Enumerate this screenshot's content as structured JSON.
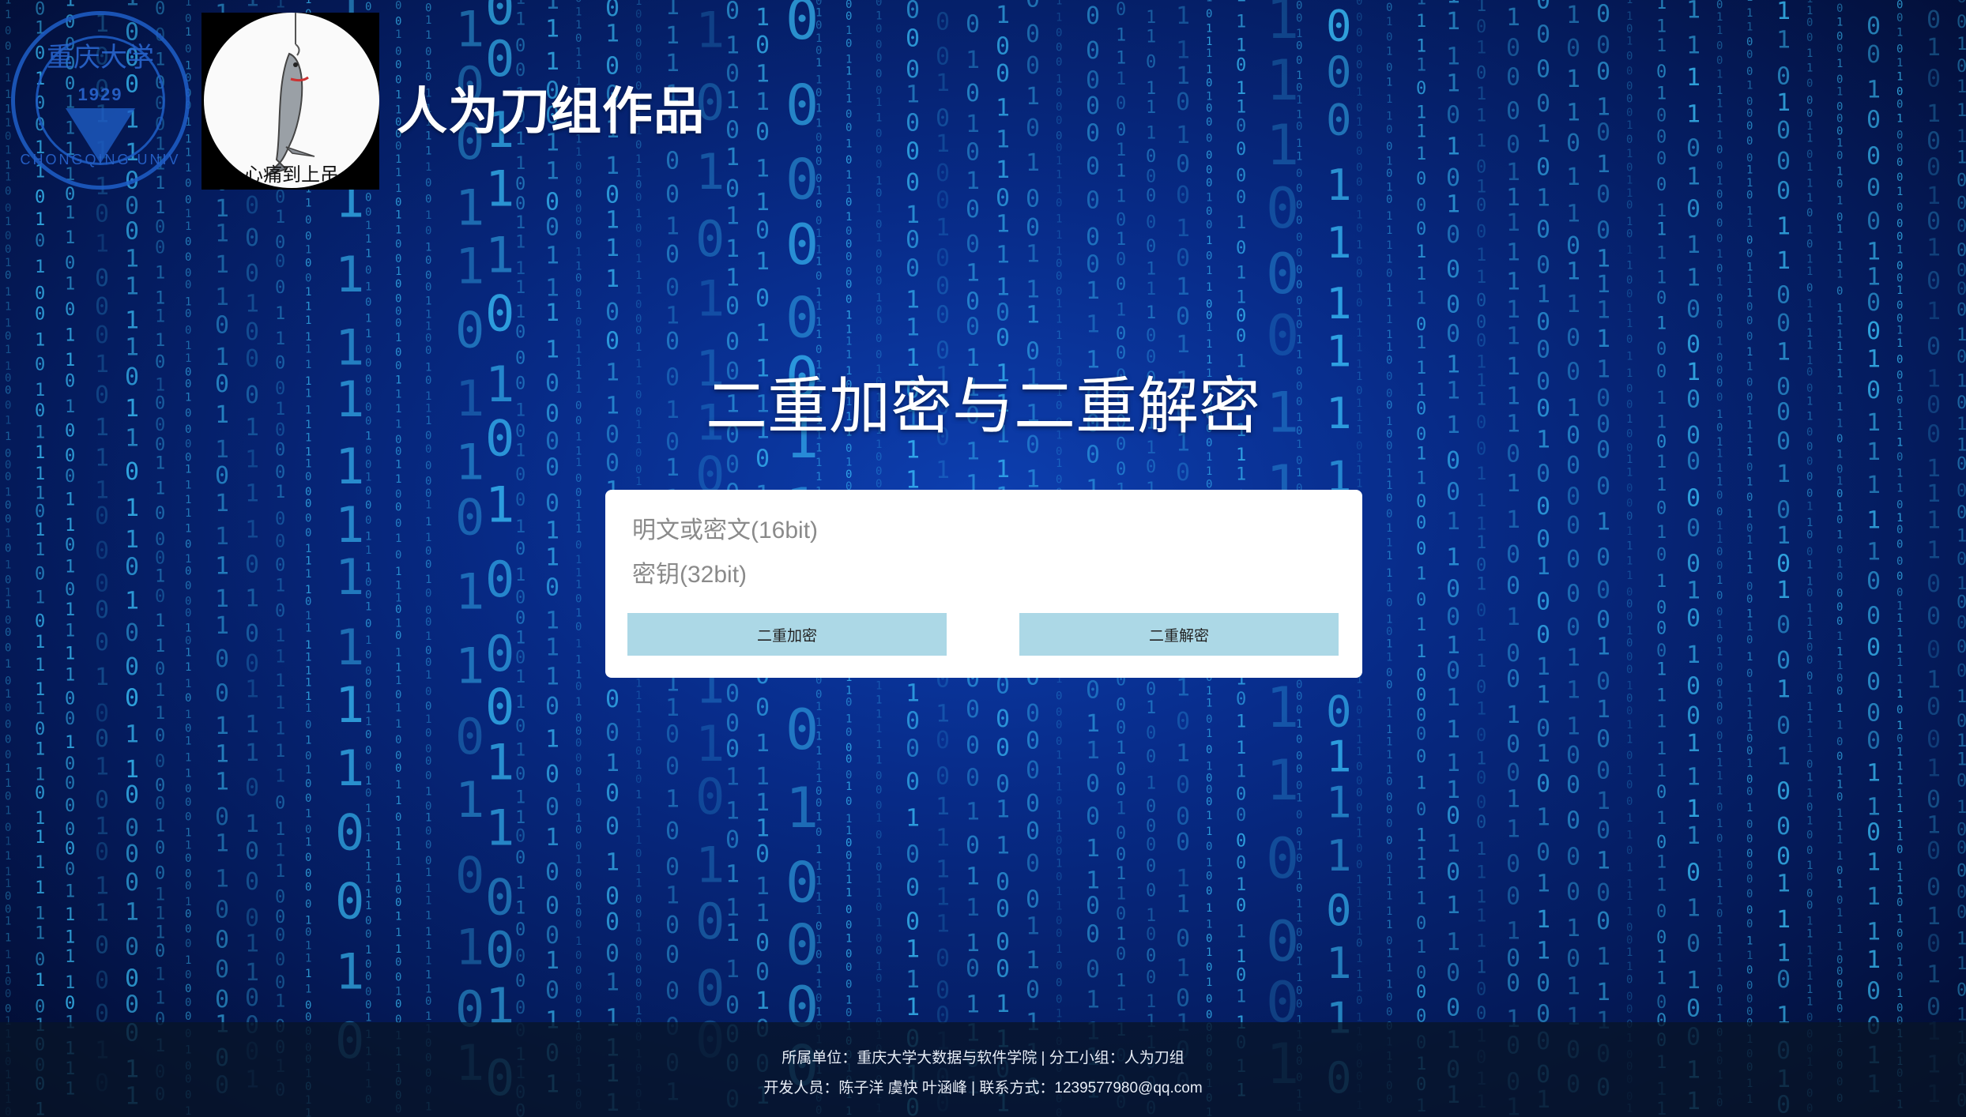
{
  "header": {
    "seal_top_text": "重庆大学",
    "seal_year": "1929",
    "seal_bottom_text": "CHONGQING UNIV",
    "avatar_caption": "心痛到上吊",
    "brand_title": "人为刀组作品"
  },
  "main": {
    "title": "二重加密与二重解密",
    "inputs": [
      {
        "placeholder": "明文或密文(16bit)",
        "value": ""
      },
      {
        "placeholder": "密钥(32bit)",
        "value": ""
      }
    ],
    "buttons": {
      "encrypt": "二重加密",
      "decrypt": "二重解密"
    }
  },
  "footer": {
    "line1": "所属单位：重庆大学大数据与软件学院 | 分工小组：人为刀组",
    "line2": "开发人员：陈子洋 虞快 叶涵峰 | 联系方式：1239577980@qq.com"
  },
  "colors": {
    "button_bg": "#acd8e6",
    "background": "#072a86",
    "digit_color": "#3cc8ff"
  }
}
